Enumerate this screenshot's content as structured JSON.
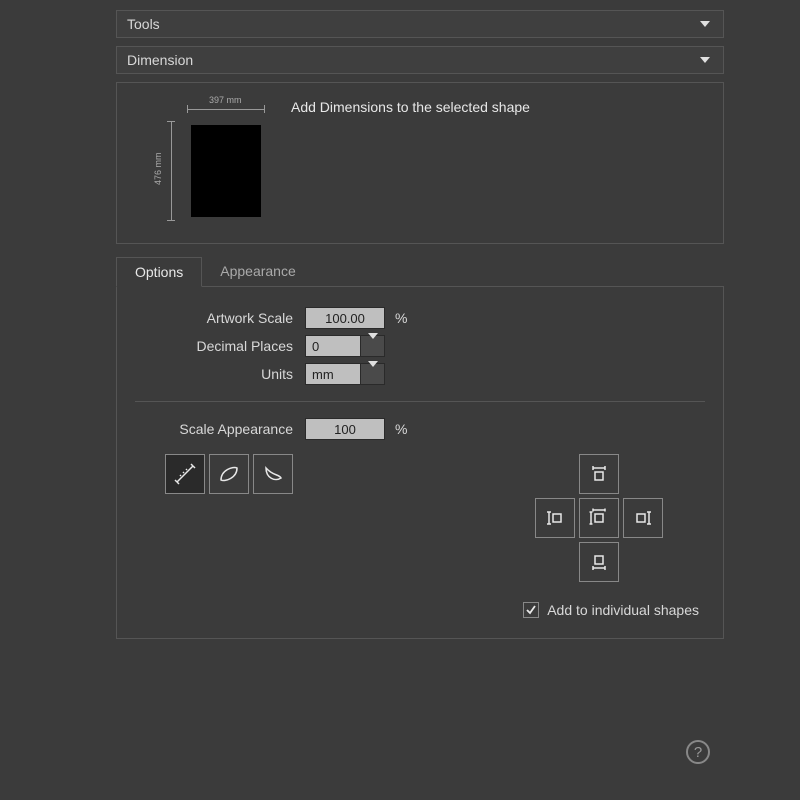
{
  "headers": {
    "tools": "Tools",
    "dimension": "Dimension"
  },
  "illustration": {
    "width_label": "397 mm",
    "height_label": "476 mm",
    "description": "Add Dimensions to the selected shape"
  },
  "tabs": {
    "options": "Options",
    "appearance": "Appearance"
  },
  "options": {
    "artwork_scale_label": "Artwork Scale",
    "artwork_scale_value": "100.00",
    "artwork_scale_suffix": "%",
    "decimal_places_label": "Decimal Places",
    "decimal_places_value": "0",
    "units_label": "Units",
    "units_value": "mm",
    "scale_appearance_label": "Scale Appearance",
    "scale_appearance_value": "100",
    "scale_appearance_suffix": "%"
  },
  "checkbox": {
    "add_individual_label": "Add to individual shapes",
    "add_individual_checked": true
  },
  "help": "?"
}
